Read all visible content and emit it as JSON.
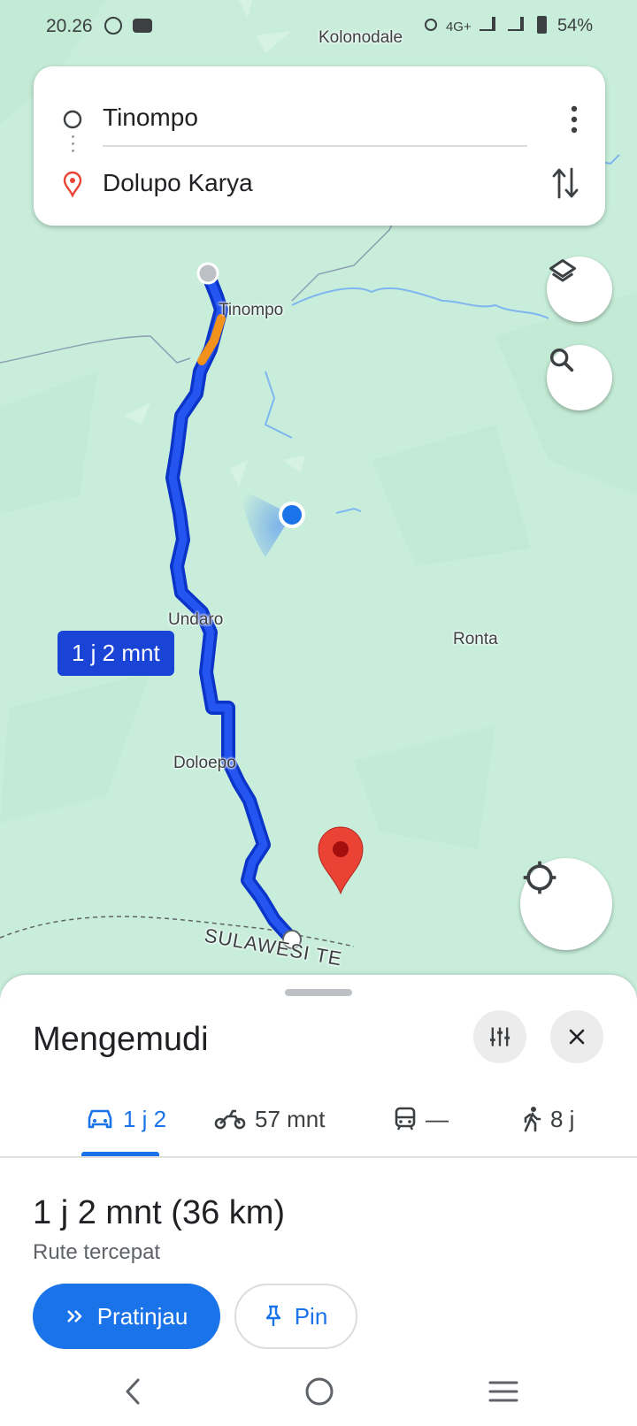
{
  "status": {
    "time": "20.26",
    "network": "4G+",
    "battery": "54%",
    "colors": {
      "text": "#3c4043"
    }
  },
  "route": {
    "origin": "Tinompo",
    "destination": "Dolupo Karya"
  },
  "map": {
    "labels": {
      "kolonodale": "Kolonodale",
      "tinompo": "Tinompo",
      "undaro": "Undaro",
      "ronta": "Ronta",
      "doloepo": "Doloepo",
      "region": "SULAWESI TE"
    },
    "eta_bubble": "1 j 2 mnt",
    "colors": {
      "route": "#1a44d6",
      "traffic": "#f2911b",
      "land": "#c8eedb",
      "pin": "#ea4335"
    }
  },
  "sheet": {
    "title": "Mengemudi",
    "modes": [
      {
        "icon": "car-icon",
        "label": "1 j 2"
      },
      {
        "icon": "motorcycle-icon",
        "label": "57 mnt"
      },
      {
        "icon": "transit-icon",
        "label": "—"
      },
      {
        "icon": "walk-icon",
        "label": "8 j"
      }
    ],
    "summary": {
      "duration": "1 j 2 mnt",
      "distance": "(36 km)",
      "note": "Rute tercepat"
    },
    "buttons": {
      "preview": "Pratinjau",
      "pin": "Pin"
    }
  }
}
